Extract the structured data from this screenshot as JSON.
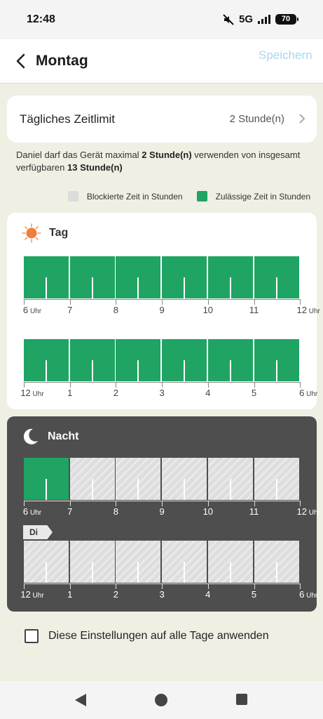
{
  "status": {
    "time": "12:48",
    "network": "5G",
    "battery": "70"
  },
  "header": {
    "title": "Montag",
    "save_label": "Speichern"
  },
  "limit": {
    "label": "Tägliches Zeitlimit",
    "value": "2 Stunde(n)"
  },
  "description": {
    "part1": "Daniel darf das Gerät maximal ",
    "limit_value": "2 Stunde(n)",
    "part2": " verwenden von insgesamt verfügbaren ",
    "available_value": "13 Stunde(n)"
  },
  "legend": {
    "blocked": "Blockierte Zeit in Stunden",
    "allowed": "Zulässige Zeit in Stunden"
  },
  "colors": {
    "allowed": "#1fa463",
    "blocked": "#dedede",
    "night_bg": "#4e4e4e"
  },
  "day": {
    "title": "Tag",
    "icon": "sun-icon",
    "rows": [
      {
        "labels": [
          "6",
          "7",
          "8",
          "9",
          "10",
          "11",
          "12"
        ],
        "states": [
          1,
          1,
          1,
          1,
          1,
          1
        ]
      },
      {
        "labels": [
          "12",
          "1",
          "2",
          "3",
          "4",
          "5",
          "6"
        ],
        "states": [
          1,
          1,
          1,
          1,
          1,
          1
        ]
      }
    ]
  },
  "night": {
    "title": "Nacht",
    "icon": "moon-icon",
    "next_day_tag": "Di",
    "rows": [
      {
        "labels": [
          "6",
          "7",
          "8",
          "9",
          "10",
          "11",
          "12"
        ],
        "states": [
          1,
          0,
          0,
          0,
          0,
          0
        ]
      },
      {
        "labels": [
          "12",
          "1",
          "2",
          "3",
          "4",
          "5",
          "6"
        ],
        "states": [
          0,
          0,
          0,
          0,
          0,
          0
        ]
      }
    ]
  },
  "unit_label": "Uhr",
  "apply_all": {
    "label": "Diese Einstellungen auf alle Tage anwenden",
    "checked": false
  }
}
